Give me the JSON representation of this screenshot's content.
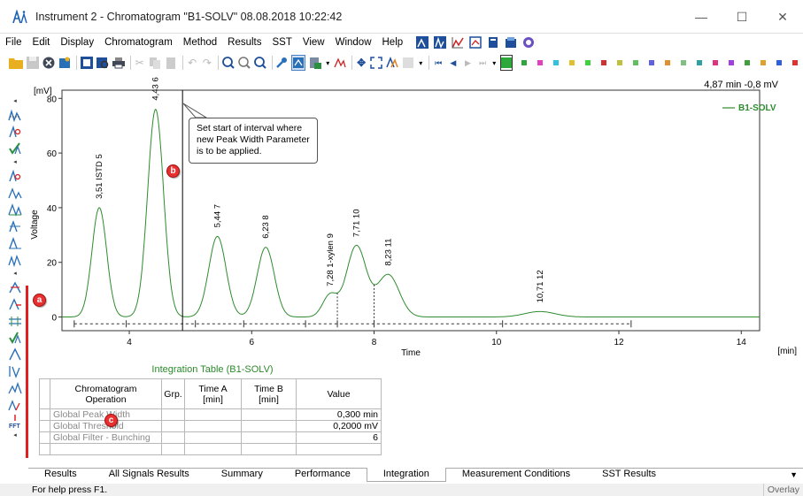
{
  "window": {
    "title": "Instrument 2 - Chromatogram \"B1-SOLV\" 08.08.2018 10:22:42",
    "minimize": "—",
    "maximize": "☐",
    "close": "✕"
  },
  "menu": [
    "File",
    "Edit",
    "Display",
    "Chromatogram",
    "Method",
    "Results",
    "SST",
    "View",
    "Window",
    "Help"
  ],
  "toolbar_colors": [
    "#2ea83a",
    "#e040c0",
    "#30c0e0",
    "#e0c030",
    "#40d040",
    "#d03030",
    "#c0c040",
    "#60c060",
    "#6060e0",
    "#e09030",
    "#80c080",
    "#30a0a0",
    "#e03080",
    "#a040e0",
    "#40a040",
    "#e0a030",
    "#3060e0",
    "#e03030"
  ],
  "chart": {
    "coord_readout": "4,87 min  -0,8 mV",
    "legend": "B1-SOLV",
    "callout_text": [
      "Set start of interval where",
      "new Peak Width Parameter",
      "is to be applied."
    ],
    "markers": {
      "a": "a",
      "b": "b",
      "c": "c"
    }
  },
  "chart_data": {
    "type": "line",
    "xlabel": "Time",
    "x_unit": "[min]",
    "ylabel": "Voltage",
    "y_unit": "[mV]",
    "xlim": [
      2.9,
      14.3
    ],
    "ylim": [
      -5,
      83
    ],
    "xticks": [
      4,
      6,
      8,
      10,
      12,
      14
    ],
    "yticks": [
      0,
      20,
      40,
      60,
      80
    ],
    "series": [
      {
        "name": "B1-SOLV",
        "color": "#2e8b2e"
      }
    ],
    "peaks": [
      {
        "rt": 3.51,
        "height": 40,
        "width": 0.12,
        "label": "3,51 ISTD  5"
      },
      {
        "rt": 4.43,
        "height": 76,
        "width": 0.13,
        "label": "4,43  6"
      },
      {
        "rt": 5.44,
        "height": 29.5,
        "width": 0.14,
        "label": "5,44  7"
      },
      {
        "rt": 6.23,
        "height": 25.5,
        "width": 0.14,
        "label": "6,23  8"
      },
      {
        "rt": 7.28,
        "height": 8,
        "width": 0.12,
        "label": "7,28 1-xylen  9"
      },
      {
        "rt": 7.71,
        "height": 26,
        "width": 0.16,
        "label": "7,71  10"
      },
      {
        "rt": 8.23,
        "height": 15.5,
        "width": 0.18,
        "label": "8,23  11"
      },
      {
        "rt": 10.71,
        "height": 2,
        "width": 0.25,
        "label": "10,71  12"
      }
    ],
    "baseline": -2.5,
    "cursor_x": 4.87
  },
  "integration": {
    "title": "Integration Table (B1-SOLV)",
    "headers": [
      "Chromatogram\nOperation",
      "Grp.",
      "Time A\n[min]",
      "Time B\n[min]",
      "Value"
    ],
    "rows": [
      {
        "op": "Global Peak Width",
        "grp": "",
        "ta": "",
        "tb": "",
        "val": "0,300 min"
      },
      {
        "op": "Global Threshold",
        "grp": "",
        "ta": "",
        "tb": "",
        "val": "0,2000 mV"
      },
      {
        "op": "Global Filter - Bunching",
        "grp": "",
        "ta": "",
        "tb": "",
        "val": "6"
      },
      {
        "op": "",
        "grp": "",
        "ta": "",
        "tb": "",
        "val": ""
      }
    ]
  },
  "tabs": [
    "Results",
    "All Signals Results",
    "Summary",
    "Performance",
    "Integration",
    "Measurement Conditions",
    "SST Results"
  ],
  "active_tab": "Integration",
  "status": {
    "left": "For help press F1.",
    "right": "Overlay"
  }
}
